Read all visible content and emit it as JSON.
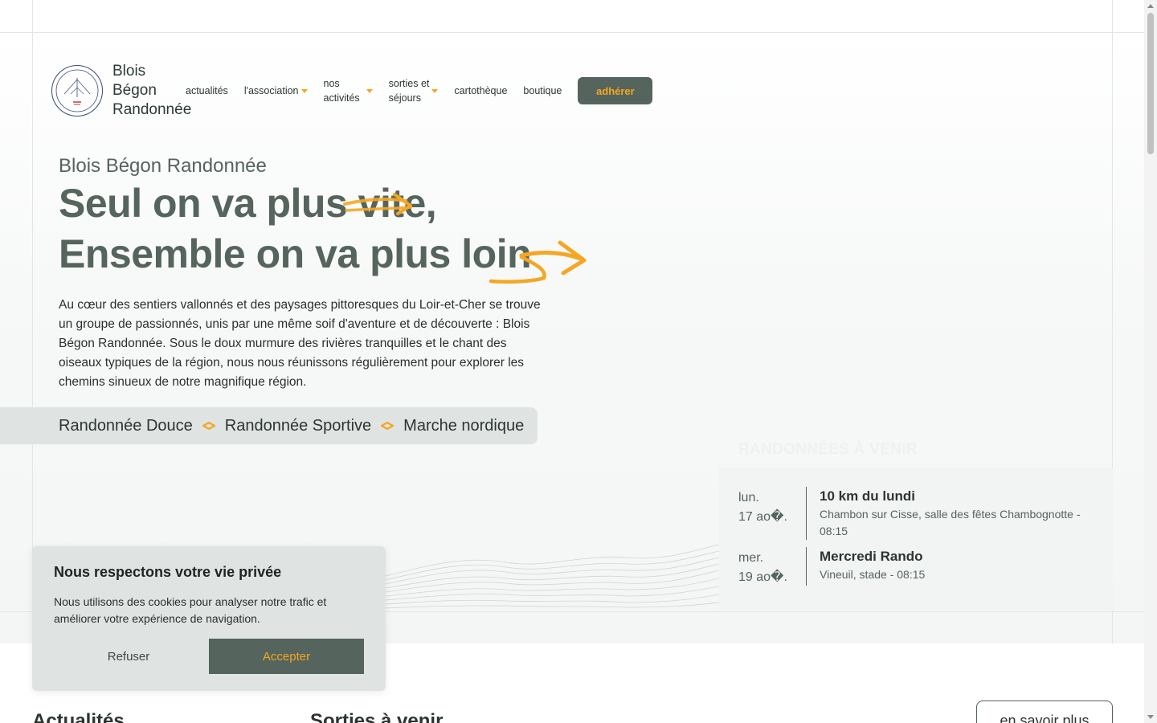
{
  "brand": {
    "name_line1": "Blois",
    "name_line2": "Bégon",
    "name_line3": "Randonnée"
  },
  "nav": {
    "items": [
      {
        "label": "actualités",
        "dropdown": false
      },
      {
        "label": "l'association",
        "dropdown": true
      },
      {
        "label_line1": "nos",
        "label_line2": "activités",
        "dropdown": true
      },
      {
        "label_line1": "sorties et",
        "label_line2": "séjours",
        "dropdown": true
      },
      {
        "label": "cartothèque",
        "dropdown": false
      },
      {
        "label": "boutique",
        "dropdown": false
      }
    ],
    "cta": "adhérer"
  },
  "hero": {
    "subtitle": "Blois Bégon Randonnée",
    "title_line1": "Seul on va plus vite,",
    "title_line2": "Ensemble on va plus loin",
    "description": "Au cœur des sentiers vallonnés et des paysages pittoresques du Loir-et-Cher se trouve un groupe de passionnés, unis par une même soif d'aventure et de découverte : Blois Bégon Randonnée. Sous le doux murmure des rivières tranquilles et le chant des oiseaux typiques de la région, nous nous réunissons régulièrement pour explorer les chemins sinueux de notre magnifique région.",
    "types": [
      "Randonnée Douce",
      "Randonnée Sportive",
      "Marche nordique"
    ]
  },
  "upcoming": {
    "title": "RANDONNÉES À VENIR",
    "hikes": [
      {
        "day": "lun.",
        "date": "17 ao�.",
        "name": "10 km du lundi",
        "place": "Chambon sur Cisse, salle des fêtes Chambognotte - 08:15"
      },
      {
        "day": "mer.",
        "date": "19 ao�.",
        "name": "Mercredi Rando",
        "place": "Vineuil, stade - 08:15"
      }
    ]
  },
  "cookie": {
    "title": "Nous respectons votre vie privée",
    "text": "Nous utilisons des cookies pour analyser notre trafic et améliorer votre expérience de navigation.",
    "refuse": "Refuser",
    "accept": "Accepter"
  },
  "sections": {
    "news_title": "Actualités",
    "outings_title": "Sorties à venir",
    "more_button": "en savoir plus"
  },
  "colors": {
    "accent": "#f5a623",
    "primary": "#55645c",
    "panel": "#dfe4e2"
  }
}
